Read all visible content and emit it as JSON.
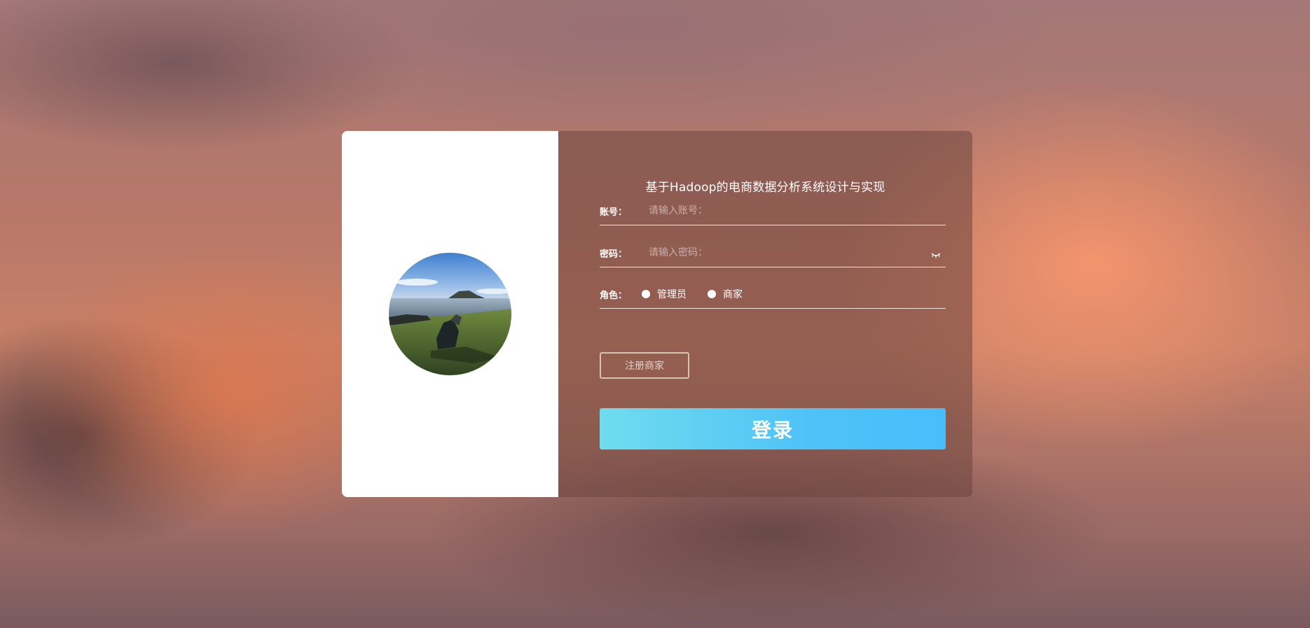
{
  "title": "基于Hadoop的电商数据分析系统设计与实现",
  "account": {
    "label": "账号：",
    "placeholder": "请输入账号："
  },
  "password": {
    "label": "密码：",
    "placeholder": "请输入密码：",
    "toggle_icon": "eye-closed-icon"
  },
  "role": {
    "label": "角色：",
    "options": [
      "管理员",
      "商家"
    ]
  },
  "buttons": {
    "register": "注册商家",
    "login": "登录"
  },
  "colors": {
    "login_button_start": "#6fdcee",
    "login_button_end": "#47bdfa",
    "left_panel": "#ffffff"
  }
}
